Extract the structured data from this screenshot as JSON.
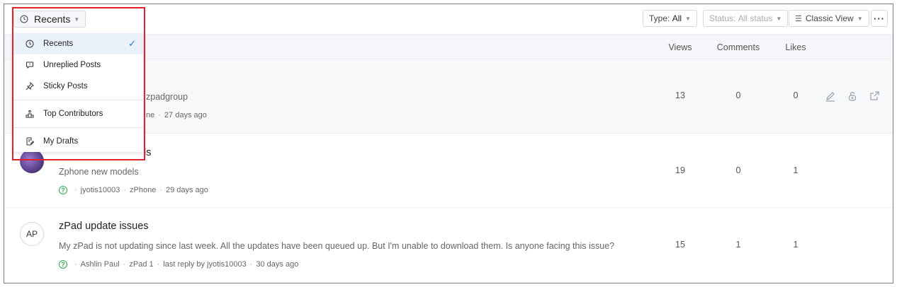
{
  "toolbar": {
    "view_selector": {
      "label": "Recents",
      "icon": "clock-icon"
    },
    "type_filter": {
      "prefix": "Type:",
      "value": "All"
    },
    "status_filter": {
      "prefix": "Status:",
      "value": "All status"
    },
    "view_mode": {
      "label": "Classic View",
      "icon": "list-icon"
    },
    "more_label": "···"
  },
  "columns": {
    "views": "Views",
    "comments": "Comments",
    "likes": "Likes"
  },
  "dropdown": {
    "items": [
      {
        "label": "Recents",
        "icon": "clock-icon",
        "selected": true
      },
      {
        "label": "Unreplied Posts",
        "icon": "chat-icon",
        "selected": false
      },
      {
        "label": "Sticky Posts",
        "icon": "pin-icon",
        "selected": false
      },
      {
        "label": "Top Contributors",
        "icon": "podium-icon",
        "selected": false
      },
      {
        "label": "My Drafts",
        "icon": "draft-icon",
        "selected": false
      }
    ],
    "check_glyph": "✓"
  },
  "posts": [
    {
      "title": "",
      "desc_partial": "zpadgroup",
      "meta_partial": "ne",
      "time": "27 days ago",
      "views": "13",
      "comments": "0",
      "likes": "0"
    },
    {
      "title_partial": "ls",
      "desc": "Zphone new models",
      "author": "jyotis10003",
      "group": "zPhone",
      "time": "29 days ago",
      "views": "19",
      "comments": "0",
      "likes": "1"
    },
    {
      "avatar_initials": "AP",
      "title": "zPad update issues",
      "desc": "My zPad is not updating since last week. All the updates have been queued up. But I'm unable to download them. Is anyone facing this issue?",
      "author": "Ashlin Paul",
      "group": "zPad 1",
      "last_reply": "last reply by jyotis10003",
      "time": "30 days ago",
      "views": "15",
      "comments": "1",
      "likes": "1"
    }
  ],
  "meta_sep": "·",
  "question_glyph": "?",
  "colors": {
    "highlight": "#e0232a",
    "accent": "#2a6fd6",
    "question": "#2fa84f"
  }
}
